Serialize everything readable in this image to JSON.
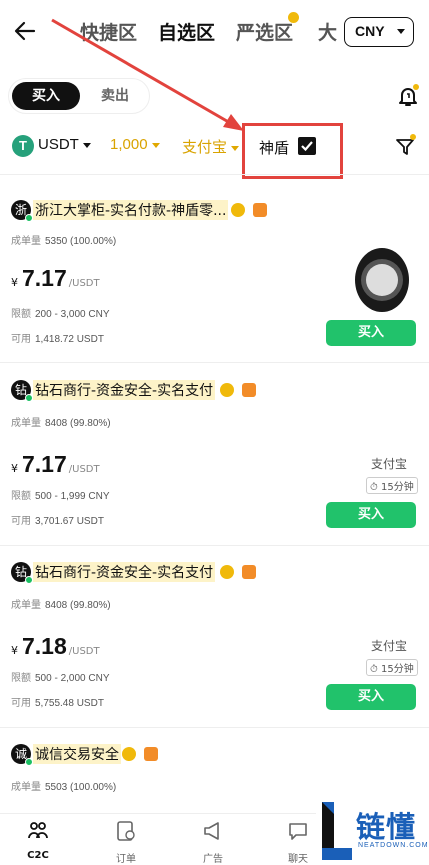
{
  "header": {
    "tabs": [
      {
        "label": "快捷区",
        "active": false
      },
      {
        "label": "自选区",
        "active": true
      },
      {
        "label": "严选区",
        "active": false
      },
      {
        "label": "大",
        "active": false
      }
    ],
    "currency": "CNY"
  },
  "trade_toggle": {
    "buy": "买入",
    "sell": "卖出",
    "selected": "买入"
  },
  "filters": {
    "coin": "USDT",
    "coin_icon_glyph": "T",
    "amount": "1,000",
    "payment": "支付宝",
    "shield_label": "神盾",
    "shield_checked": true
  },
  "labels": {
    "orders": "成单量",
    "limit": "限额",
    "available": "可用",
    "buy": "买入",
    "yen": "¥",
    "unit": "/USDT"
  },
  "listings": [
    {
      "avatar": "浙",
      "merchant": "浙江大掌柜-实名付款-神盾零...",
      "orders": "5350 (100.00%)",
      "price": "7.17",
      "limit": "200 - 3,000 CNY",
      "available": "1,418.72 USDT",
      "payment": "",
      "time": ""
    },
    {
      "avatar": "钻",
      "merchant": "钻石商行-资金安全-实名支付",
      "orders": "8408 (99.80%)",
      "price": "7.17",
      "limit": "500 - 1,999 CNY",
      "available": "3,701.67 USDT",
      "payment": "支付宝",
      "time": "15分钟"
    },
    {
      "avatar": "钻",
      "merchant": "钻石商行-资金安全-实名支付",
      "orders": "8408 (99.80%)",
      "price": "7.18",
      "limit": "500 - 2,000 CNY",
      "available": "5,755.48 USDT",
      "payment": "支付宝",
      "time": "15分钟"
    },
    {
      "avatar": "诚",
      "merchant": "诚信交易安全",
      "orders": "5503 (100.00%)"
    }
  ],
  "bottom_nav": [
    {
      "label": "C2C",
      "icon": "people-icon",
      "active": true
    },
    {
      "label": "订单",
      "icon": "order-icon",
      "active": false
    },
    {
      "label": "广告",
      "icon": "megaphone-icon",
      "active": false
    },
    {
      "label": "聊天",
      "icon": "chat-icon",
      "active": false
    }
  ],
  "watermark": {
    "text": "链懂",
    "sub": "NEATDOWN.COM"
  },
  "colors": {
    "accent_green": "#21c26b",
    "gold": "#d9a300",
    "highlight_red": "#e2433d",
    "usdt": "#26a17b"
  }
}
